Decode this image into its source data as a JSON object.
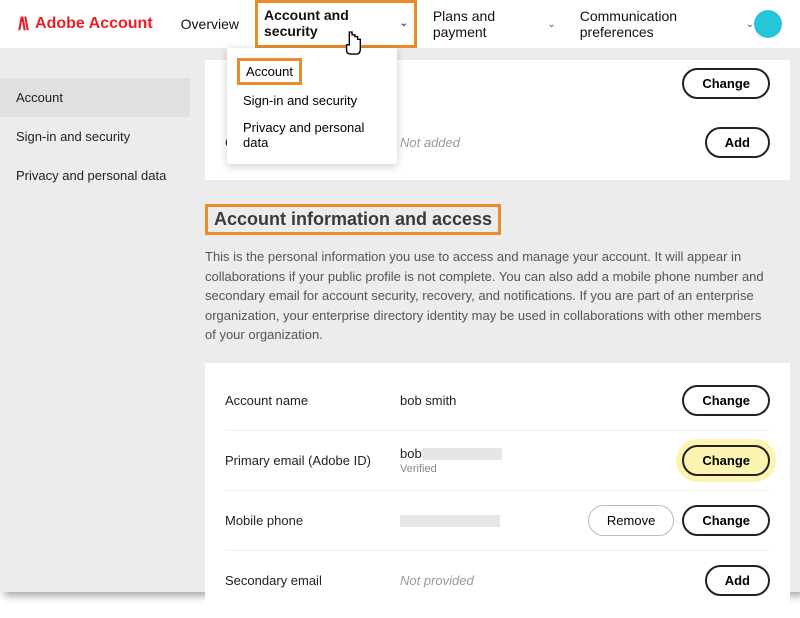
{
  "brand": "Adobe Account",
  "nav": {
    "overview": "Overview",
    "account_security": "Account and security",
    "plans": "Plans and payment",
    "comm": "Communication preferences"
  },
  "dropdown": {
    "account": "Account",
    "signin": "Sign-in and security",
    "privacy": "Privacy and personal data"
  },
  "sidebar": {
    "account": "Account",
    "signin": "Sign-in and security",
    "privacy": "Privacy and personal data"
  },
  "top_row": {
    "label_c": "C",
    "value_not_added": "Not added",
    "change": "Change",
    "add": "Add"
  },
  "section": {
    "title": "Account information and access",
    "desc": "This is the personal information you use to access and manage your account. It will appear in collaborations if your public profile is not complete. You can also add a mobile phone number and secondary email for account security, recovery, and notifications. If you are part of an enterprise organization, your enterprise directory identity may be used in collaborations with other members of your organization."
  },
  "fields": {
    "account_name": {
      "label": "Account name",
      "value": "bob smith",
      "action": "Change"
    },
    "primary_email": {
      "label": "Primary email (Adobe ID)",
      "value": "bob",
      "status": "Verified",
      "action": "Change"
    },
    "mobile": {
      "label": "Mobile phone",
      "remove": "Remove",
      "change": "Change"
    },
    "secondary": {
      "label": "Secondary email",
      "value": "Not provided",
      "action": "Add"
    }
  }
}
